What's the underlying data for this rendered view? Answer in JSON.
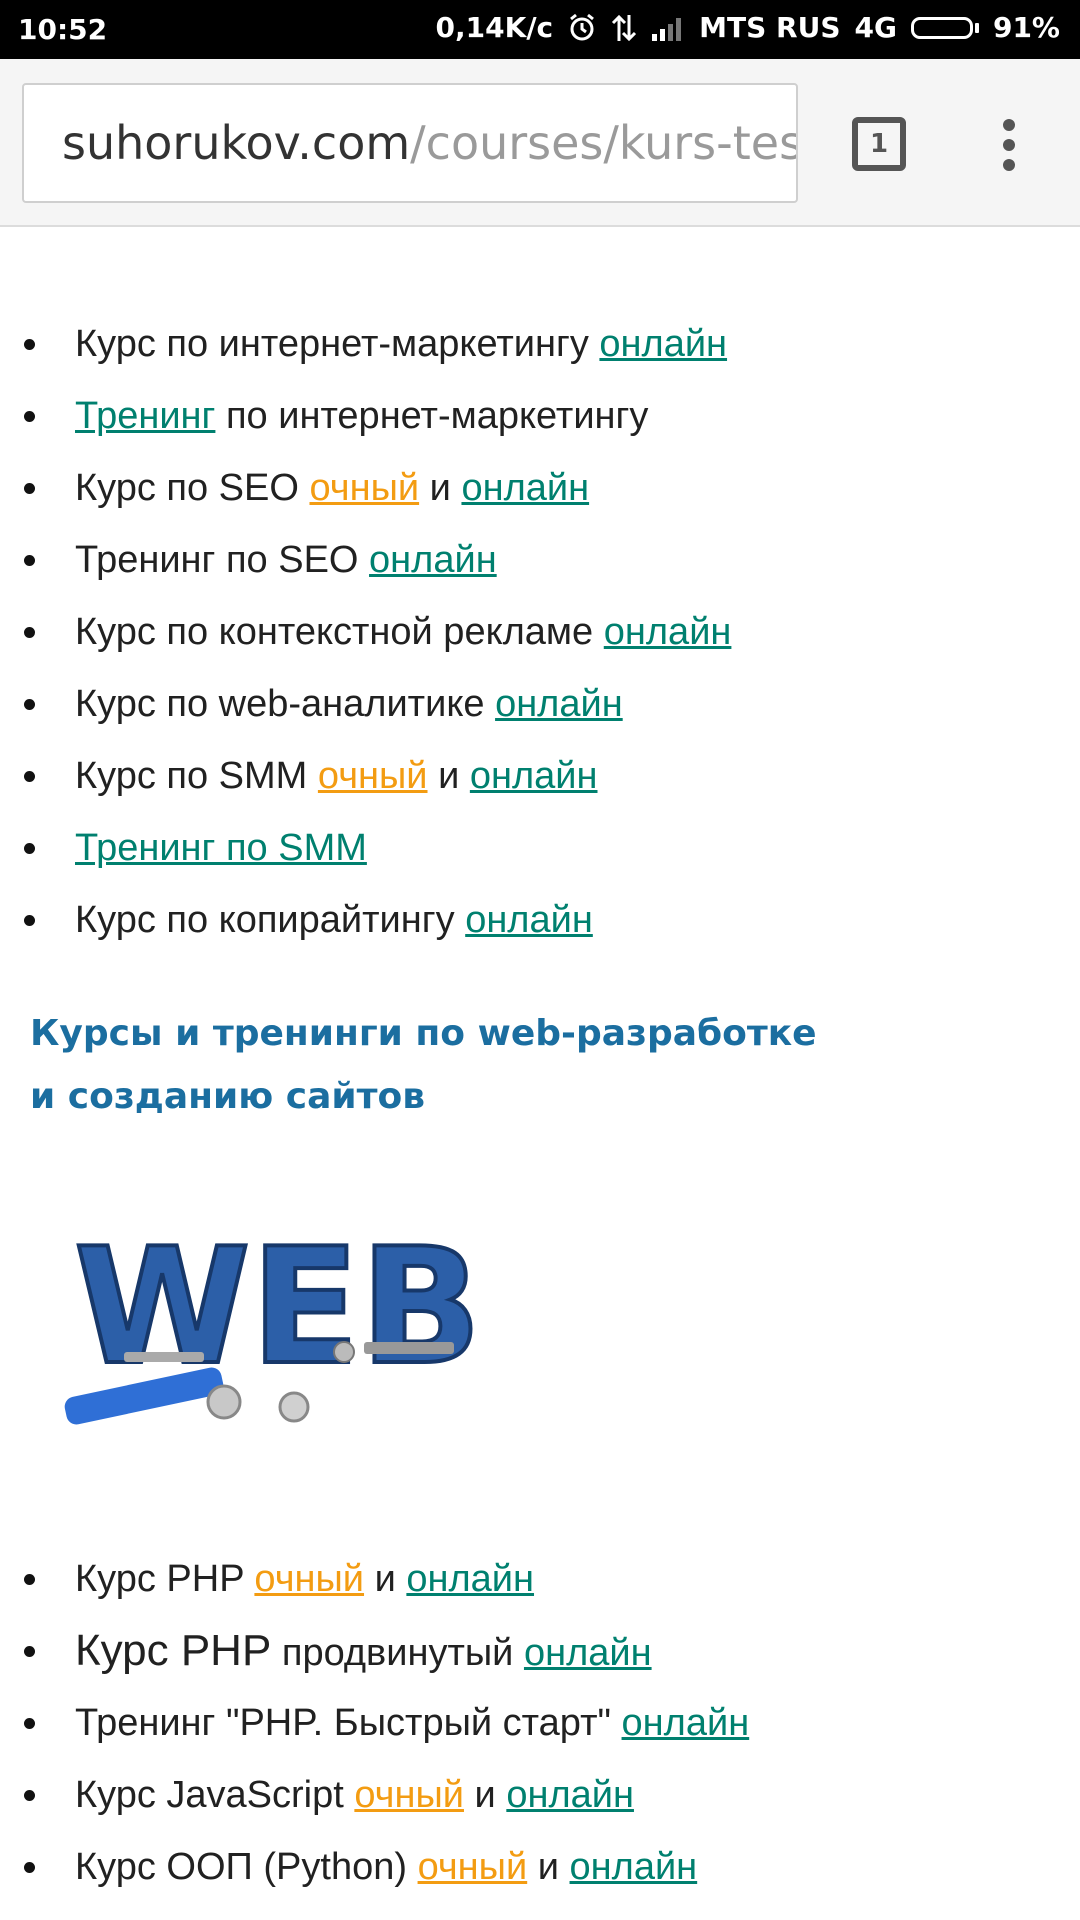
{
  "status_bar": {
    "time": "10:52",
    "speed": "0,14K/c",
    "carrier": "MTS RUS",
    "network": "4G",
    "battery": "91%",
    "battery_level": 0.91
  },
  "browser": {
    "url_domain": "suhorukov.com",
    "url_path": "/courses/kurs-test",
    "tab_count": "1"
  },
  "labels": {
    "online": "онлайн",
    "ochny": "очный",
    "and": " и "
  },
  "list1": [
    {
      "text": "Курс по интернет-маркетингу "
    },
    {
      "link": "Тренинг",
      "text": " по интернет-маркетингу"
    },
    {
      "text": "Курс по SEO "
    },
    {
      "text": "Тренинг по SEO "
    },
    {
      "text": "Курс по контекстной рекламе "
    },
    {
      "text": "Курс по web-аналитике "
    },
    {
      "text": "Курс по SMM "
    },
    {
      "link": "Тренинг по SMM"
    },
    {
      "text": "Курс по копирайтингу "
    }
  ],
  "heading": "Курсы и тренинги по web-разработке и созданию сайтов",
  "image": {
    "text": "WEB"
  },
  "list2": [
    {
      "text": "Курс PHP "
    },
    {
      "big": "Курс PHP",
      "text": " продвинутый "
    },
    {
      "text": "Тренинг \"PHP. Быстрый старт\" "
    },
    {
      "text": "Курс JavaScript "
    },
    {
      "text": "Курс ООП (Python) "
    }
  ]
}
